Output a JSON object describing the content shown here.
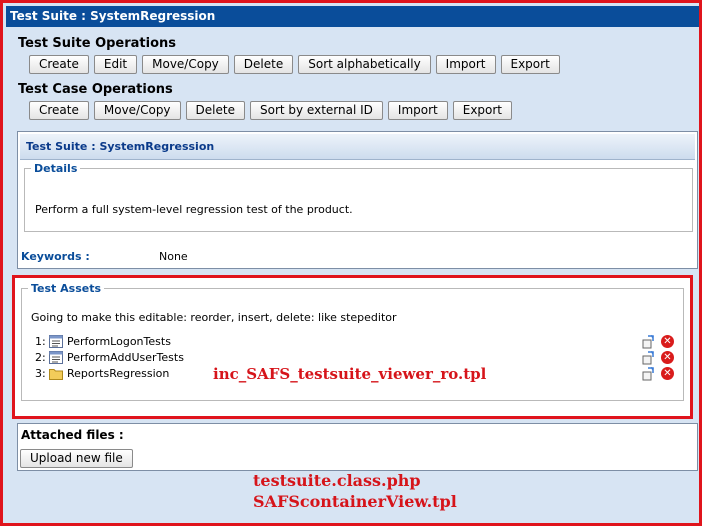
{
  "window": {
    "title": "Test Suite : SystemRegression"
  },
  "suite_ops": {
    "heading": "Test Suite Operations",
    "buttons": [
      "Create",
      "Edit",
      "Move/Copy",
      "Delete",
      "Sort alphabetically",
      "Import",
      "Export"
    ]
  },
  "case_ops": {
    "heading": "Test Case Operations",
    "buttons": [
      "Create",
      "Move/Copy",
      "Delete",
      "Sort by external ID",
      "Import",
      "Export"
    ]
  },
  "suite_panel": {
    "header": "Test Suite : SystemRegression",
    "details_legend": "Details",
    "details_text": "Perform a full system-level regression test of the product.",
    "keywords_label": "Keywords :",
    "keywords_value": "None"
  },
  "test_assets": {
    "legend": "Test Assets",
    "note": "Going to make this editable: reorder, insert, delete: like stepeditor",
    "items": [
      {
        "num": "1:",
        "name": "PerformLogonTests",
        "icon": "testcase-icon"
      },
      {
        "num": "2:",
        "name": "PerformAddUserTests",
        "icon": "testcase-icon"
      },
      {
        "num": "3:",
        "name": "ReportsRegression",
        "icon": "folder-icon"
      }
    ]
  },
  "attachments": {
    "label": "Attached files :",
    "upload_button": "Upload new file"
  },
  "annotations": {
    "viewer_tpl": "inc_SAFS_testsuite_viewer_ro.tpl",
    "class_php": "testsuite.class.php",
    "container_tpl": "SAFScontainerView.tpl"
  },
  "colors": {
    "title_bar": "#0a4d9a",
    "page_bg": "#d7e4f3",
    "annotation_red": "#e0141c",
    "link_blue": "#0a4d9a"
  }
}
